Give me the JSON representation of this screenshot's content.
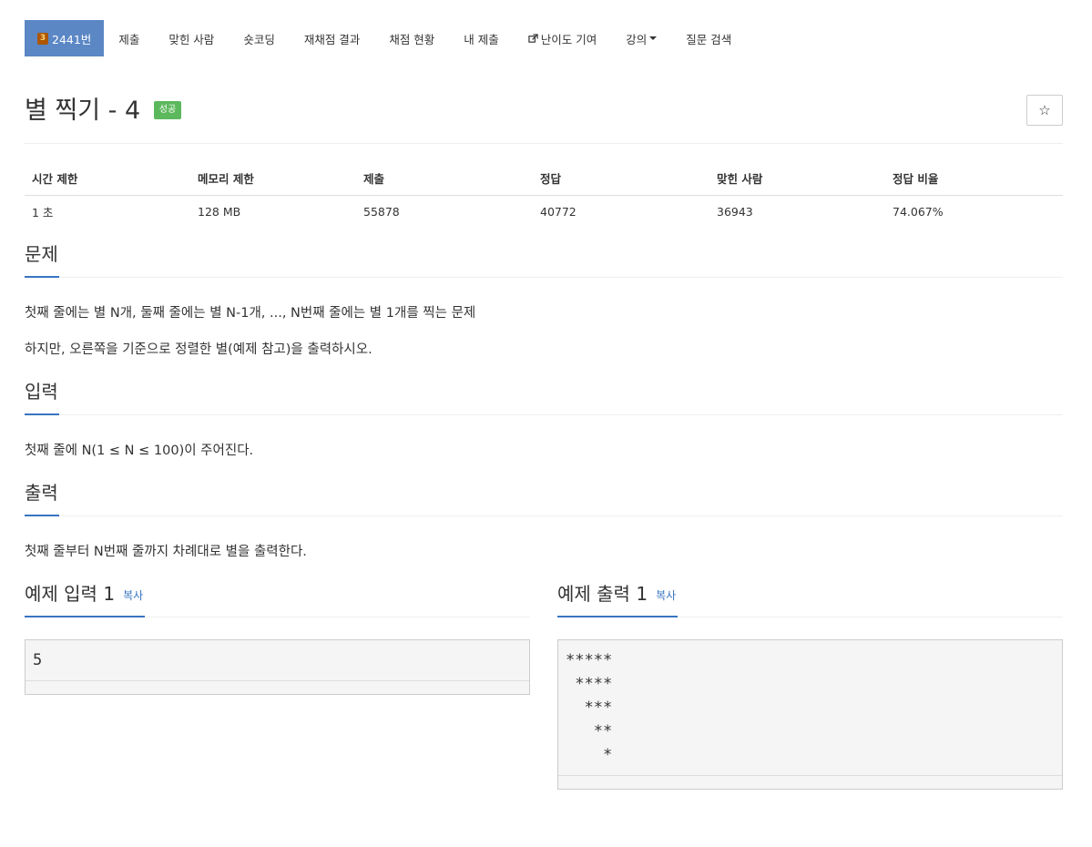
{
  "nav": {
    "problem_tier": "3",
    "problem_number": "2441번",
    "tabs": [
      "제출",
      "맞힌 사람",
      "숏코딩",
      "재채점 결과",
      "채점 현황",
      "내 제출"
    ],
    "difficulty": "난이도 기여",
    "lecture": "강의",
    "qna": "질문 검색",
    "active_color": "#5b87c5"
  },
  "problem": {
    "title": "별 찍기 - 4",
    "result": "성공",
    "star": "☆"
  },
  "info": {
    "headers": [
      "시간 제한",
      "메모리 제한",
      "제출",
      "정답",
      "맞힌 사람",
      "정답 비율"
    ],
    "values": [
      "1 초",
      "128 MB",
      "55878",
      "40772",
      "36943",
      "74.067%"
    ]
  },
  "sections": {
    "description": {
      "title": "문제",
      "lines": [
        "첫째 줄에는 별 N개, 둘째 줄에는 별 N-1개, ..., N번째 줄에는 별 1개를 찍는 문제",
        "하지만, 오른쪽을 기준으로 정렬한 별(예제 참고)을 출력하시오."
      ]
    },
    "input": {
      "title": "입력",
      "text": "첫째 줄에 N(1 ≤ N ≤ 100)이 주어진다."
    },
    "output": {
      "title": "출력",
      "text": "첫째 줄부터 N번째 줄까지 차례대로 별을 출력한다."
    }
  },
  "samples": {
    "input_title": "예제 입력 1",
    "output_title": "예제 출력 1",
    "copy_label": "복사",
    "input_value": "5",
    "output_value": "*****\n ****\n  ***\n   **\n    *"
  }
}
